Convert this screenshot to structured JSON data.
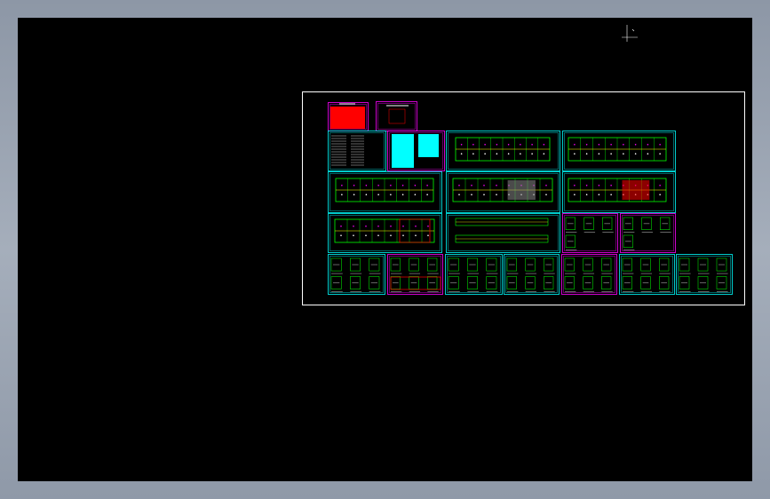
{
  "viewport": {
    "background": "#000000",
    "frame_color": "#ffffff"
  },
  "sheet_colors": {
    "frame": "#00ffff",
    "title_frame": "#ff00ff",
    "wall": "#00ff00",
    "accent_yellow": "#ffff00",
    "accent_red": "#ff0000",
    "accent_magenta": "#ff00ff",
    "text": "#ffffff",
    "cyan_fill": "#00ffff",
    "cover_fill": "#ff0000"
  },
  "icons": {
    "ucs": "ucs-icon"
  }
}
